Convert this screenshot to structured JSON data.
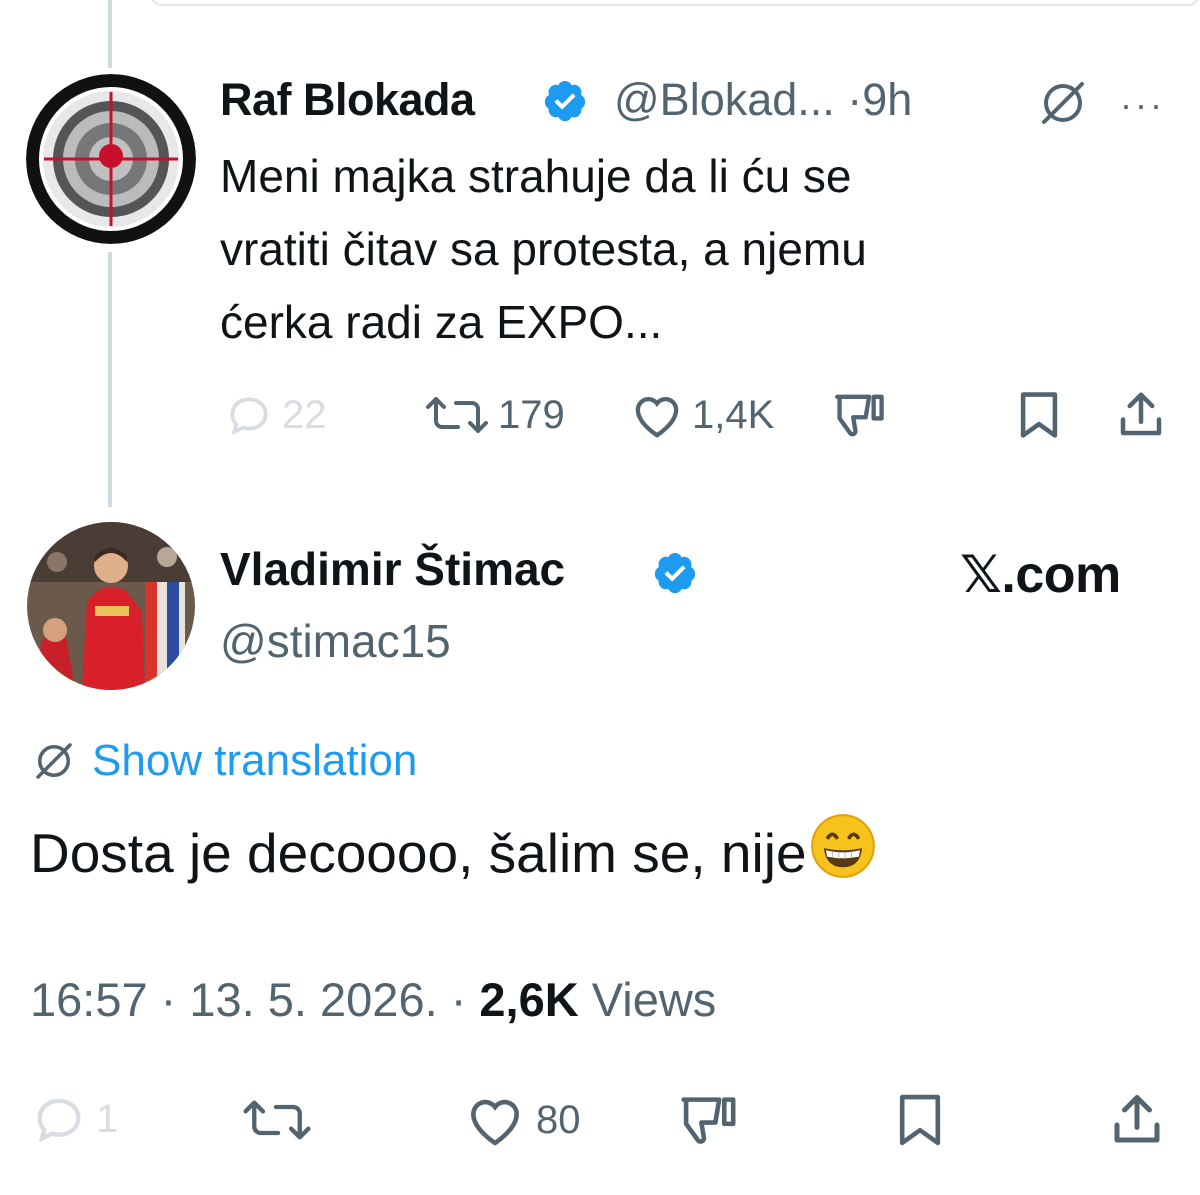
{
  "parent_tweet": {
    "author_name": "Raf Blokada",
    "handle_time": "@Blokad... ·9h",
    "more_label": "···",
    "text_lines": [
      "Meni majka strahuje da li ću se",
      "vratiti čitav sa protesta, a njemu",
      "ćerka radi za EXPO..."
    ],
    "replies": "22",
    "reposts": "179",
    "likes": "1,4K"
  },
  "main_tweet": {
    "author_name": "Vladimir Štimac",
    "handle": "@stimac15",
    "brand": "𝕏.com",
    "show_translation": "Show translation",
    "text": "Dosta je decoooo, šalim se, nije",
    "time_date": "16:57 · 13. 5. 2026. · ",
    "views_count": "2,6K",
    "views_label": " Views",
    "replies": "1",
    "likes": "80"
  },
  "colors": {
    "verified": "#1d9bf0",
    "link": "#1d9bf0",
    "secondary_text": "#536471",
    "primary_text": "#0f1419"
  }
}
